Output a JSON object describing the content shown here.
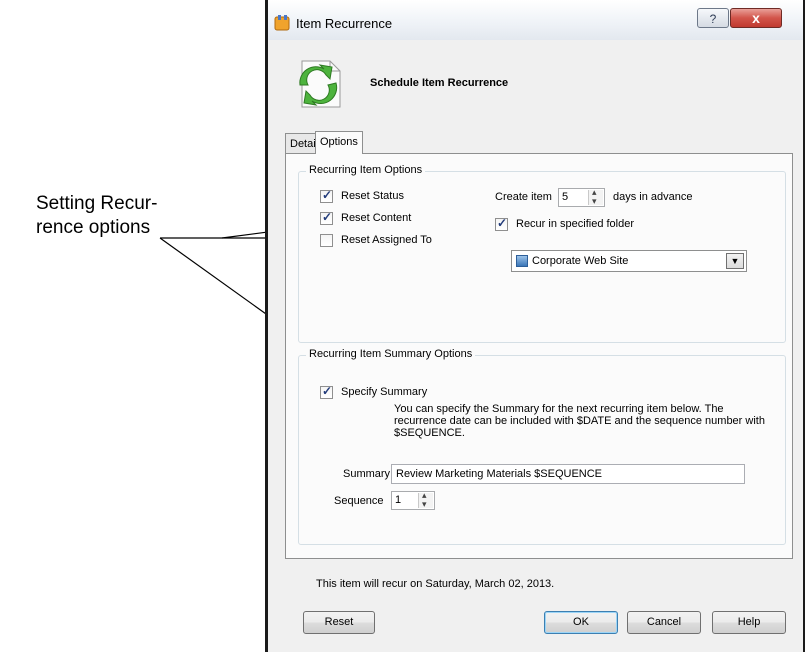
{
  "annotation": {
    "line1": "Setting Recur-",
    "line2": "rence options"
  },
  "window": {
    "title": "Item Recurrence",
    "help_glyph": "?",
    "close_glyph": "x"
  },
  "header": {
    "title": "Schedule Item Recurrence"
  },
  "tabs": [
    {
      "label": "Details"
    },
    {
      "label": "Options"
    }
  ],
  "recurring_options": {
    "group_title": "Recurring Item Options",
    "reset_status": {
      "label": "Reset Status",
      "checked": true
    },
    "reset_content": {
      "label": "Reset Content",
      "checked": true
    },
    "reset_assigned": {
      "label": "Reset Assigned To",
      "checked": false
    },
    "create_item_label": "Create item",
    "create_item_value": "5",
    "days_label": "days in advance",
    "recur_folder": {
      "label": "Recur in specified folder",
      "checked": true
    },
    "folder_value": "Corporate Web Site"
  },
  "summary_options": {
    "group_title": "Recurring Item Summary Options",
    "specify_summary": {
      "label": "Specify Summary",
      "checked": true
    },
    "description": "You can specify the Summary for the next recurring item below. The recurrence date can be included with $DATE and the sequence number with $SEQUENCE.",
    "summary_label": "Summary",
    "summary_value": "Review Marketing Materials $SEQUENCE",
    "sequence_label": "Sequence",
    "sequence_value": "1"
  },
  "footer": {
    "recur_text": "This item will recur on Saturday, March 02, 2013.",
    "reset": "Reset",
    "ok": "OK",
    "cancel": "Cancel",
    "help": "Help"
  },
  "icons": {
    "title_icon": "recurrence-icon",
    "header_icon": "document-refresh-icon",
    "folder_icon": "website-icon"
  }
}
